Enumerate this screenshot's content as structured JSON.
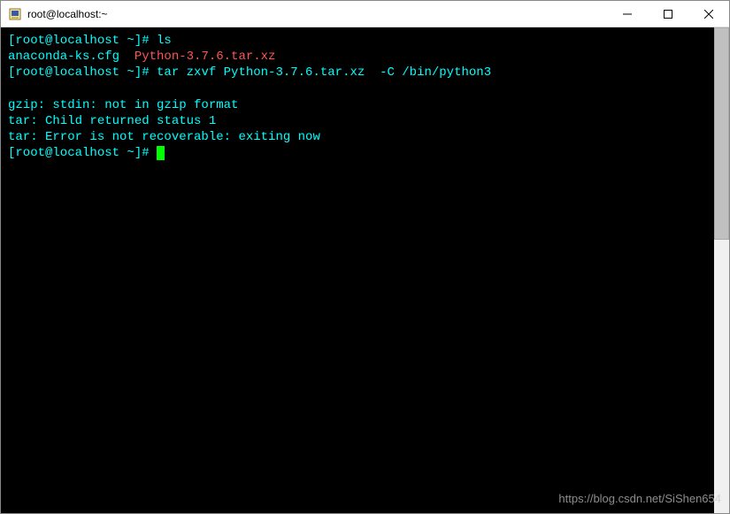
{
  "window": {
    "title": "root@localhost:~"
  },
  "terminal": {
    "lines": [
      {
        "segments": [
          {
            "text": "[root@localhost ~]# ",
            "cls": "prompt"
          },
          {
            "text": "ls",
            "cls": "cmd"
          }
        ]
      },
      {
        "segments": [
          {
            "text": "anaconda-ks.cfg  ",
            "cls": "file-normal"
          },
          {
            "text": "Python-3.7.6.tar.xz",
            "cls": "file-highlight"
          }
        ]
      },
      {
        "segments": [
          {
            "text": "[root@localhost ~]# ",
            "cls": "prompt"
          },
          {
            "text": "tar zxvf Python-3.7.6.tar.xz  -C /bin/python3",
            "cls": "cmd"
          }
        ]
      },
      {
        "segments": [
          {
            "text": " ",
            "cls": "cmd"
          }
        ]
      },
      {
        "segments": [
          {
            "text": "gzip: stdin: not in gzip format",
            "cls": "cmd"
          }
        ]
      },
      {
        "segments": [
          {
            "text": "tar: Child returned status 1",
            "cls": "cmd"
          }
        ]
      },
      {
        "segments": [
          {
            "text": "tar: Error is not recoverable: exiting now",
            "cls": "cmd"
          }
        ]
      },
      {
        "segments": [
          {
            "text": "[root@localhost ~]# ",
            "cls": "prompt"
          }
        ],
        "cursor": true
      }
    ]
  },
  "watermark": "https://blog.csdn.net/SiShen654"
}
